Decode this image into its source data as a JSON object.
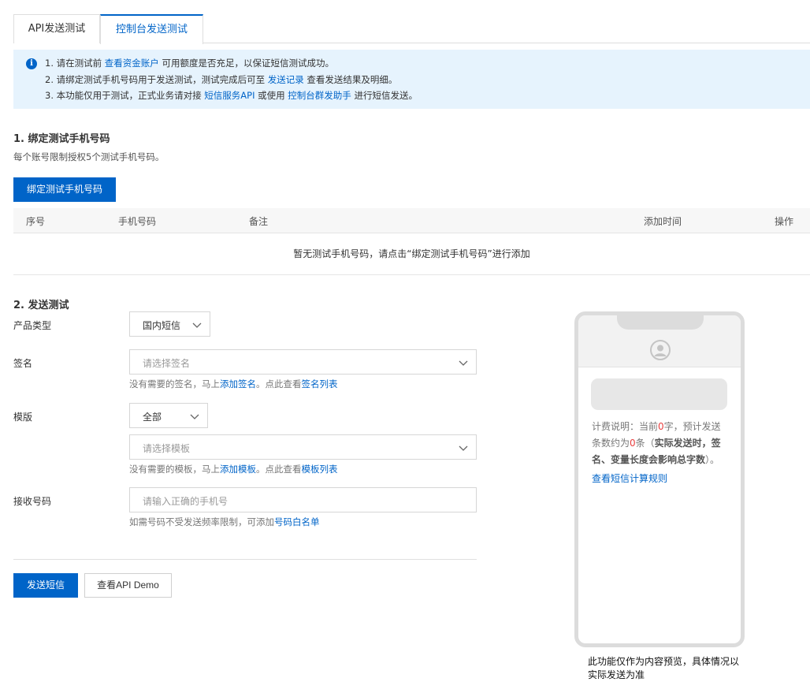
{
  "tabs": [
    {
      "label": "API发送测试",
      "active": false
    },
    {
      "label": "控制台发送测试",
      "active": true
    }
  ],
  "notice": {
    "line1": {
      "prefix": "1. 请在测试前 ",
      "link": "查看资金账户",
      "suffix": " 可用额度是否充足，以保证短信测试成功。"
    },
    "line2": {
      "prefix": "2. 请绑定测试手机号码用于发送测试，测试完成后可至 ",
      "link": "发送记录",
      "suffix": " 查看发送结果及明细。"
    },
    "line3": {
      "prefix": "3. 本功能仅用于测试，正式业务请对接 ",
      "link1": "短信服务API",
      "middle": " 或使用 ",
      "link2": "控制台群发助手",
      "suffix": " 进行短信发送。"
    }
  },
  "section1": {
    "title": "1. 绑定测试手机号码",
    "desc": "每个账号限制授权5个测试手机号码。",
    "bind_button": "绑定测试手机号码",
    "columns": [
      "序号",
      "手机号码",
      "备注",
      "添加时间",
      "操作"
    ],
    "empty_text": "暂无测试手机号码，请点击“绑定测试手机号码”进行添加"
  },
  "section2": {
    "title": "2. 发送测试",
    "product_label": "产品类型",
    "product_value": "国内短信",
    "sign_label": "签名",
    "sign_placeholder": "请选择签名",
    "sign_helper": {
      "prefix": "没有需要的签名，马上",
      "link1": "添加签名",
      "middle": "。点此查看",
      "link2": "签名列表"
    },
    "template_label": "模版",
    "template_filter_value": "全部",
    "template_placeholder": "请选择模板",
    "template_helper": {
      "prefix": "没有需要的模板，马上",
      "link1": "添加模板",
      "middle": "。点此查看",
      "link2": "模板列表"
    },
    "phone_label": "接收号码",
    "phone_placeholder": "请输入正确的手机号",
    "phone_helper": {
      "prefix": "如需号码不受发送频率限制，可添加",
      "link": "号码白名单"
    },
    "send_button": "发送短信",
    "demo_button": "查看API Demo"
  },
  "phone_preview": {
    "billing_prefix": "计费说明：当前",
    "char_count": "0",
    "billing_mid1": "字，预计发送条数约为",
    "msg_count": "0",
    "billing_mid2": "条（",
    "billing_bold": "实际发送时，签名、变量长度会影响总字数",
    "billing_suffix": "）。",
    "rule_link": "查看短信计算规则",
    "note": "此功能仅作为内容预览，具体情况以实际发送为准"
  },
  "colors": {
    "accent": "#0064c8",
    "notice_bg": "#e6f3fd",
    "count_red": "#e83f3f"
  }
}
